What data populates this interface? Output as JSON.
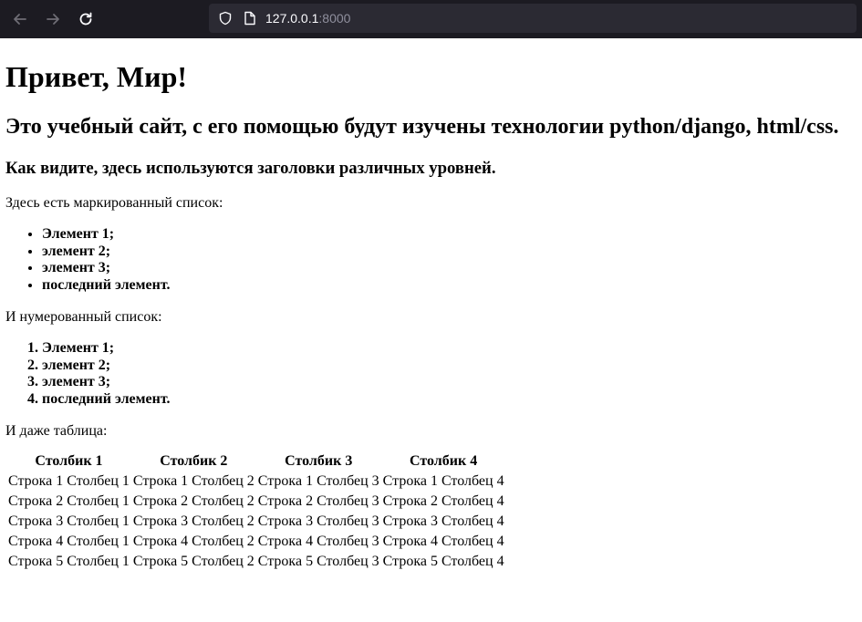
{
  "browser": {
    "url_host": "127.0.0.1",
    "url_port": ":8000"
  },
  "page": {
    "h1": "Привет, Мир!",
    "h2": "Это учебный сайт, с его помощью будут изучены технологии python/django, html/css.",
    "h3": "Как видите, здесь используются заголовки различных уровней.",
    "ul_intro": "Здесь есть маркированный список:",
    "ul_items": [
      "Элемент 1;",
      "элемент 2;",
      "элемент 3;",
      "последний элемент."
    ],
    "ol_intro": "И нумерованный список:",
    "ol_items": [
      "Элемент 1;",
      "элемент 2;",
      "элемент 3;",
      "последний элемент."
    ],
    "table_intro": "И даже таблица:",
    "table": {
      "headers": [
        "Столбик 1",
        "Столбик 2",
        "Столбик 3",
        "Столбик 4"
      ],
      "rows": [
        [
          "Строка 1 Столбец 1",
          "Строка 1 Столбец 2",
          "Строка 1 Столбец 3",
          "Строка 1 Столбец 4"
        ],
        [
          "Строка 2 Столбец 1",
          "Строка 2 Столбец 2",
          "Строка 2 Столбец 3",
          "Строка 2 Столбец 4"
        ],
        [
          "Строка 3 Столбец 1",
          "Строка 3 Столбец 2",
          "Строка 3 Столбец 3",
          "Строка 3 Столбец 4"
        ],
        [
          "Строка 4 Столбец 1",
          "Строка 4 Столбец 2",
          "Строка 4 Столбец 3",
          "Строка 4 Столбец 4"
        ],
        [
          "Строка 5 Столбец 1",
          "Строка 5 Столбец 2",
          "Строка 5 Столбец 3",
          "Строка 5 Столбец 4"
        ]
      ]
    }
  },
  "icons": {
    "back": "back-arrow-icon",
    "forward": "forward-arrow-icon",
    "reload": "reload-icon",
    "shield": "shield-icon",
    "page": "page-icon"
  },
  "colors": {
    "toolbar_bg": "#1c1b22",
    "urlbar_bg": "#2b2a33",
    "url_text": "#fbfbfe",
    "url_dim": "#8f8f9d"
  }
}
